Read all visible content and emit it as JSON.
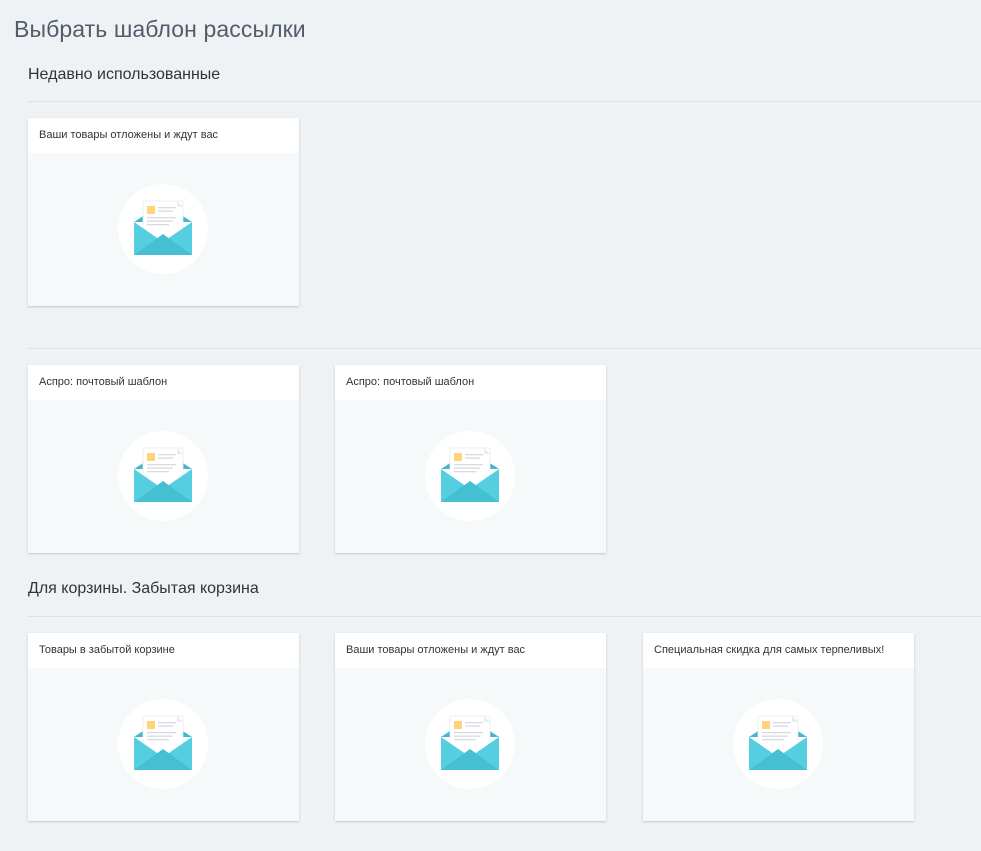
{
  "page": {
    "title": "Выбрать шаблон рассылки"
  },
  "sections": {
    "recent": {
      "title": "Недавно использованные",
      "cards": [
        {
          "title": "Ваши товары отложены и ждут вас",
          "icon": "envelope-letter-icon"
        }
      ]
    },
    "aspro": {
      "title": "",
      "cards": [
        {
          "title": "Аспро: почтовый шаблон",
          "icon": "envelope-letter-icon"
        },
        {
          "title": "Аспро: почтовый шаблон",
          "icon": "envelope-letter-icon"
        }
      ]
    },
    "cart": {
      "title": "Для корзины. Забытая корзина",
      "cards": [
        {
          "title": "Товары в забытой корзине",
          "icon": "envelope-letter-icon"
        },
        {
          "title": "Ваши товары отложены и ждут вас",
          "icon": "envelope-letter-icon"
        },
        {
          "title": "Специальная скидка для самых терпеливых!",
          "icon": "envelope-letter-icon"
        }
      ]
    }
  },
  "colors": {
    "background": "#eef2f4",
    "card_body": "#f5f9fa",
    "envelope": "#55cfe0",
    "envelope_dark": "#3fb8cc",
    "letter_square": "#fdd47a"
  }
}
